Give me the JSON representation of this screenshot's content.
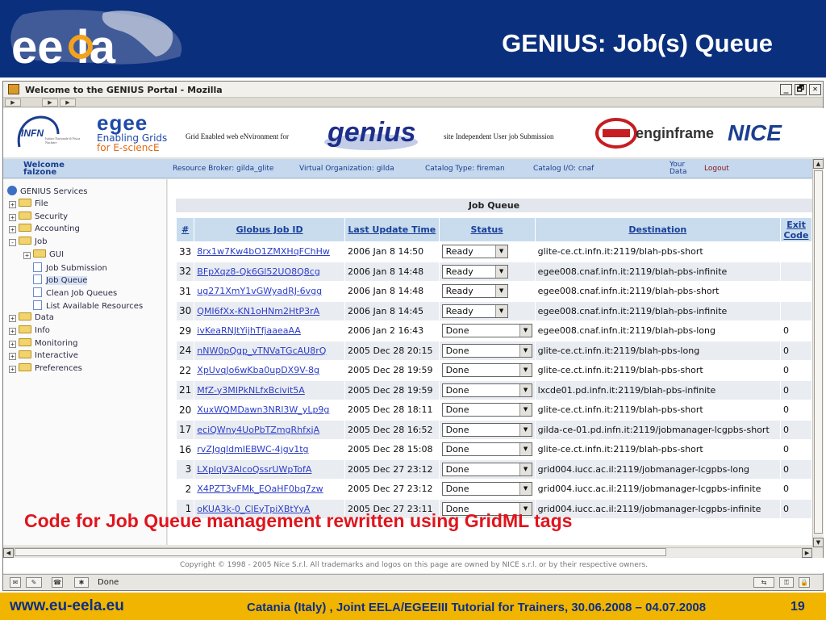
{
  "slide": {
    "title": "GENIUS: Job(s) Queue",
    "logo_text": "ee la",
    "overlay_note": "Code for Job Queue management rewritten using GridML tags",
    "footer_url": "www.eu-eela.eu",
    "footer_info": "Catania (Italy) , Joint EELA/EGEEIII Tutorial for Trainers, 30.06.2008 – 04.07.2008",
    "page_number": "19"
  },
  "browser": {
    "window_title": "Welcome to the GENIUS Portal - Mozilla",
    "minimize": "_",
    "maximize": "🗗",
    "close": "✕",
    "status": "Done"
  },
  "portal_header": {
    "infn_label": "INFN",
    "infn_sub": "Istituto Nazionale di Fisica Nucleare",
    "egee_logo": "egee",
    "egee_tag1": "Enabling Grids",
    "egee_tag2": "for E-sciencE",
    "genius_expansion": "Grid Enabled web eNvironment for",
    "genius_logo": "genius",
    "site_expansion": "site Independent User job Submission",
    "enginframe_logo": "enginframe",
    "nice_logo": "NICE"
  },
  "infobar": {
    "welcome": "Welcome",
    "user": "falzone",
    "resource_broker": "Resource Broker: gilda_glite",
    "vo": "Virtual Organization: gilda",
    "catalog_type": "Catalog Type: fireman",
    "catalog_io": "Catalog I/O: cnaf",
    "your_data_1": "Your",
    "your_data_2": "Data",
    "logout": "Logout"
  },
  "sidebar": {
    "root": "GENIUS Services",
    "items": [
      {
        "label": "File",
        "type": "folder",
        "expander": "+",
        "level": 0
      },
      {
        "label": "Security",
        "type": "folder",
        "expander": "+",
        "level": 0
      },
      {
        "label": "Accounting",
        "type": "folder",
        "expander": "+",
        "level": 0
      },
      {
        "label": "Job",
        "type": "folder",
        "expander": "-",
        "level": 0
      },
      {
        "label": "GUI",
        "type": "folder",
        "expander": "+",
        "level": 1
      },
      {
        "label": "Job Submission",
        "type": "page",
        "expander": "",
        "level": 1
      },
      {
        "label": "Job Queue",
        "type": "page",
        "expander": "",
        "level": 1,
        "selected": true
      },
      {
        "label": "Clean Job Queues",
        "type": "page",
        "expander": "",
        "level": 1
      },
      {
        "label": "List Available Resources",
        "type": "page",
        "expander": "",
        "level": 1
      },
      {
        "label": "Data",
        "type": "folder",
        "expander": "+",
        "level": 0
      },
      {
        "label": "Info",
        "type": "folder",
        "expander": "+",
        "level": 0
      },
      {
        "label": "Monitoring",
        "type": "folder",
        "expander": "+",
        "level": 0
      },
      {
        "label": "Interactive",
        "type": "folder",
        "expander": "+",
        "level": 0
      },
      {
        "label": "Preferences",
        "type": "folder",
        "expander": "+",
        "level": 0
      }
    ]
  },
  "job_queue": {
    "title": "Job Queue",
    "columns": [
      "#",
      "Globus Job ID",
      "Last Update Time",
      "Status",
      "Destination",
      "Exit Code"
    ],
    "rows": [
      {
        "num": "33",
        "id": "8rx1w7Kw4bO1ZMXHqFChHw",
        "updated": "2006 Jan 8 14:50",
        "status": "Ready",
        "dest": "glite-ce.ct.infn.it:2119/blah-pbs-short",
        "exit": ""
      },
      {
        "num": "32",
        "id": "BFpXqz8-Qk6Gl52UO8Q8cg",
        "updated": "2006 Jan 8 14:48",
        "status": "Ready",
        "dest": "egee008.cnaf.infn.it:2119/blah-pbs-infinite",
        "exit": ""
      },
      {
        "num": "31",
        "id": "ug271XmY1vGWyadRJ-6vgg",
        "updated": "2006 Jan 8 14:48",
        "status": "Ready",
        "dest": "egee008.cnaf.infn.it:2119/blah-pbs-short",
        "exit": ""
      },
      {
        "num": "30",
        "id": "QMI6fXx-KN1oHNm2HtP3rA",
        "updated": "2006 Jan 8 14:45",
        "status": "Ready",
        "dest": "egee008.cnaf.infn.it:2119/blah-pbs-infinite",
        "exit": ""
      },
      {
        "num": "29",
        "id": "ivKeaRNJtYijhTfjaaeaAA",
        "updated": "2006 Jan 2 16:43",
        "status": "Done",
        "dest": "egee008.cnaf.infn.it:2119/blah-pbs-long",
        "exit": "0"
      },
      {
        "num": "24",
        "id": "nNW0pQgp_vTNVaTGcAU8rQ",
        "updated": "2005 Dec 28 20:15",
        "status": "Done",
        "dest": "glite-ce.ct.infn.it:2119/blah-pbs-long",
        "exit": "0"
      },
      {
        "num": "22",
        "id": "XpUvqJo6wKba0upDX9V-8g",
        "updated": "2005 Dec 28 19:59",
        "status": "Done",
        "dest": "glite-ce.ct.infn.it:2119/blah-pbs-short",
        "exit": "0"
      },
      {
        "num": "21",
        "id": "MfZ-y3MIPkNLfxBcivit5A",
        "updated": "2005 Dec 28 19:59",
        "status": "Done",
        "dest": "lxcde01.pd.infn.it:2119/blah-pbs-infinite",
        "exit": "0"
      },
      {
        "num": "20",
        "id": "XuxWQMDawn3NRl3W_yLp9g",
        "updated": "2005 Dec 28 18:11",
        "status": "Done",
        "dest": "glite-ce.ct.infn.it:2119/blah-pbs-short",
        "exit": "0"
      },
      {
        "num": "17",
        "id": "eciQWny4UoPbTZmgRhfxjA",
        "updated": "2005 Dec 28 16:52",
        "status": "Done",
        "dest": "gilda-ce-01.pd.infn.it:2119/jobmanager-lcgpbs-short",
        "exit": "0"
      },
      {
        "num": "16",
        "id": "rvZJgqldmIEBWC-4jgv1tg",
        "updated": "2005 Dec 28 15:08",
        "status": "Done",
        "dest": "glite-ce.ct.infn.it:2119/blah-pbs-short",
        "exit": "0"
      },
      {
        "num": "3",
        "id": "LXplqV3AlcoQssrUWpTofA",
        "updated": "2005 Dec 27 23:12",
        "status": "Done",
        "dest": "grid004.iucc.ac.il:2119/jobmanager-lcgpbs-long",
        "exit": "0"
      },
      {
        "num": "2",
        "id": "X4PZT3vFMk_EOaHF0bq7zw",
        "updated": "2005 Dec 27 23:12",
        "status": "Done",
        "dest": "grid004.iucc.ac.il:2119/jobmanager-lcgpbs-infinite",
        "exit": "0"
      },
      {
        "num": "1",
        "id": "oKUA3k-0_ClEyTpiXBtYyA",
        "updated": "2005 Dec 27 23:11",
        "status": "Done",
        "dest": "grid004.iucc.ac.il:2119/jobmanager-lcgpbs-infinite",
        "exit": "0"
      }
    ]
  },
  "copyright": "Copyright © 1998 - 2005 Nice S.r.l. All trademarks and logos on this page are owned by NICE s.r.l. or by their respective owners.",
  "colors": {
    "header_blue": "#0a2f7d",
    "footer_yellow": "#f1b500",
    "note_red": "#e0141c",
    "link_blue": "#2c3dc9"
  }
}
